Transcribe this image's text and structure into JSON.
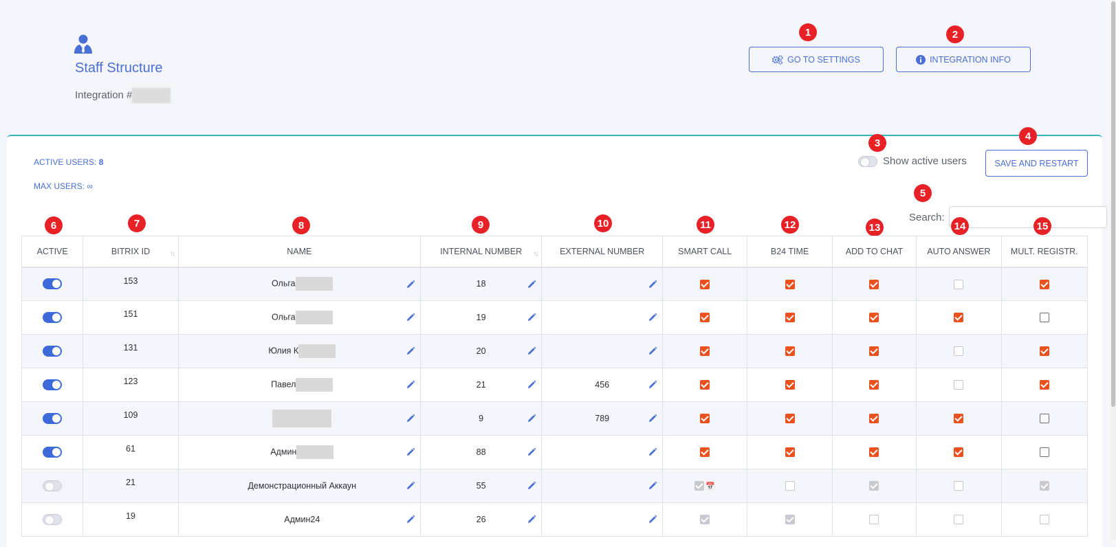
{
  "header": {
    "title": "Staff Structure",
    "integration_label": "Integration #",
    "settings_button": "GO TO SETTINGS",
    "info_button": "INTEGRATION INFO"
  },
  "stats": {
    "active_users_label": "ACTIVE USERS: ",
    "active_users_value": "8",
    "max_users_label": "MAX USERS: ",
    "max_users_value": "∞"
  },
  "controls": {
    "show_active_label": "Show active users",
    "show_active_on": false,
    "save_button": "SAVE AND RESTART",
    "search_label": "Search:",
    "search_value": ""
  },
  "badges": [
    "1",
    "2",
    "3",
    "4",
    "5",
    "6",
    "7",
    "8",
    "9",
    "10",
    "11",
    "12",
    "13",
    "14",
    "15"
  ],
  "table": {
    "columns": [
      "ACTIVE",
      "BITRIX ID",
      "NAME",
      "INTERNAL NUMBER",
      "EXTERNAL NUMBER",
      "SMART CALL",
      "B24 TIME",
      "ADD TO CHAT",
      "AUTO ANSWER",
      "MULT. REGISTR."
    ],
    "rows": [
      {
        "active": true,
        "id": "153",
        "name": "Ольга",
        "internal": "18",
        "external": "",
        "smart": "on",
        "b24": "on",
        "chat": "on",
        "auto": "offl",
        "mult": "on"
      },
      {
        "active": true,
        "id": "151",
        "name": "Ольга",
        "internal": "19",
        "external": "",
        "smart": "on",
        "b24": "on",
        "chat": "on",
        "auto": "on",
        "mult": "off"
      },
      {
        "active": true,
        "id": "131",
        "name": "Юлия К",
        "internal": "20",
        "external": "",
        "smart": "on",
        "b24": "on",
        "chat": "on",
        "auto": "offl",
        "mult": "on"
      },
      {
        "active": true,
        "id": "123",
        "name": "Павел",
        "internal": "21",
        "external": "456",
        "smart": "on",
        "b24": "on",
        "chat": "on",
        "auto": "offl",
        "mult": "on"
      },
      {
        "active": true,
        "id": "109",
        "name": "",
        "internal": "9",
        "external": "789",
        "smart": "on",
        "b24": "on",
        "chat": "on",
        "auto": "on",
        "mult": "off"
      },
      {
        "active": true,
        "id": "61",
        "name": "Админ",
        "internal": "88",
        "external": "",
        "smart": "on",
        "b24": "on",
        "chat": "on",
        "auto": "on",
        "mult": "off"
      },
      {
        "active": false,
        "id": "21",
        "name": "Демонстрационный Аккаун",
        "internal": "55",
        "external": "",
        "smart": "dis",
        "b24": "offl",
        "chat": "dis",
        "auto": "offl",
        "mult": "dis"
      },
      {
        "active": false,
        "id": "19",
        "name": "Админ24",
        "internal": "26",
        "external": "",
        "smart": "dis",
        "b24": "dis",
        "chat": "offl",
        "auto": "offl",
        "mult": "offl"
      }
    ]
  },
  "colors": {
    "accent": "#4a6fd6",
    "badge": "#e82127",
    "checkbox_on": "#e9521f",
    "card_border": "#39b3c0"
  },
  "icons": {
    "page": "user-tie-icon",
    "settings": "gears-icon",
    "info": "info-circle-icon",
    "edit": "pencil-icon",
    "calendar": "calendar-icon"
  }
}
